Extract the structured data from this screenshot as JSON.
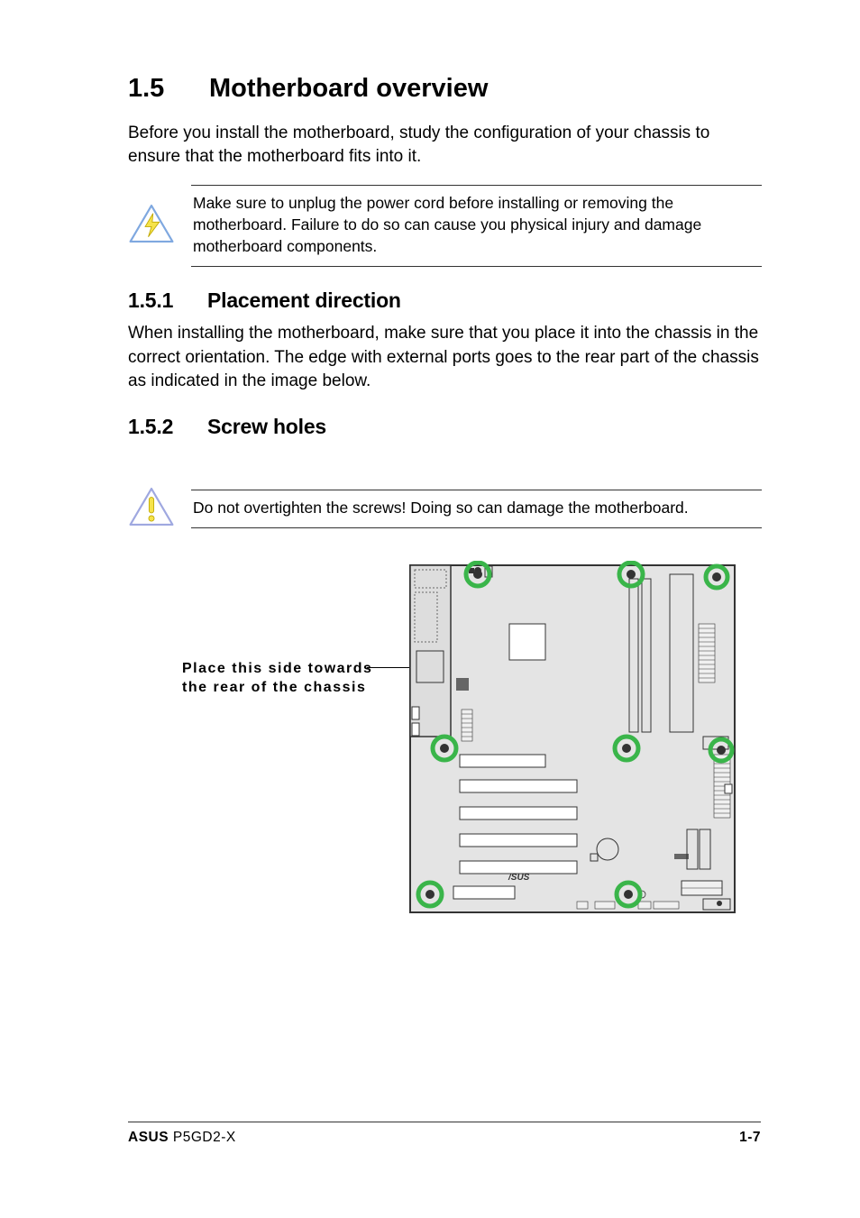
{
  "heading1": {
    "number": "1.5",
    "title": "Motherboard overview"
  },
  "intro": "Before you install the motherboard, study the configuration of your chassis to ensure that the motherboard fits into it.",
  "warning1": "Make sure to unplug the power cord before installing or removing the motherboard. Failure to do so can cause you physical injury and damage motherboard components.",
  "section1": {
    "number": "1.5.1",
    "title": "Placement direction",
    "body": "When installing the motherboard, make sure that you place it into the chassis in the correct orientation. The edge with external ports goes to the rear part of the chassis as indicated in the image below."
  },
  "section2": {
    "number": "1.5.2",
    "title": "Screw holes"
  },
  "caution1": "Do not overtighten the screws! Doing so can damage the motherboard.",
  "diagram": {
    "rear_label_line1": "Place this side towards",
    "rear_label_line2": "the rear of the chassis",
    "brand_on_board": "/SUS"
  },
  "footer": {
    "brand": "ASUS",
    "model": "P5GD2-X",
    "page": "1-7"
  }
}
